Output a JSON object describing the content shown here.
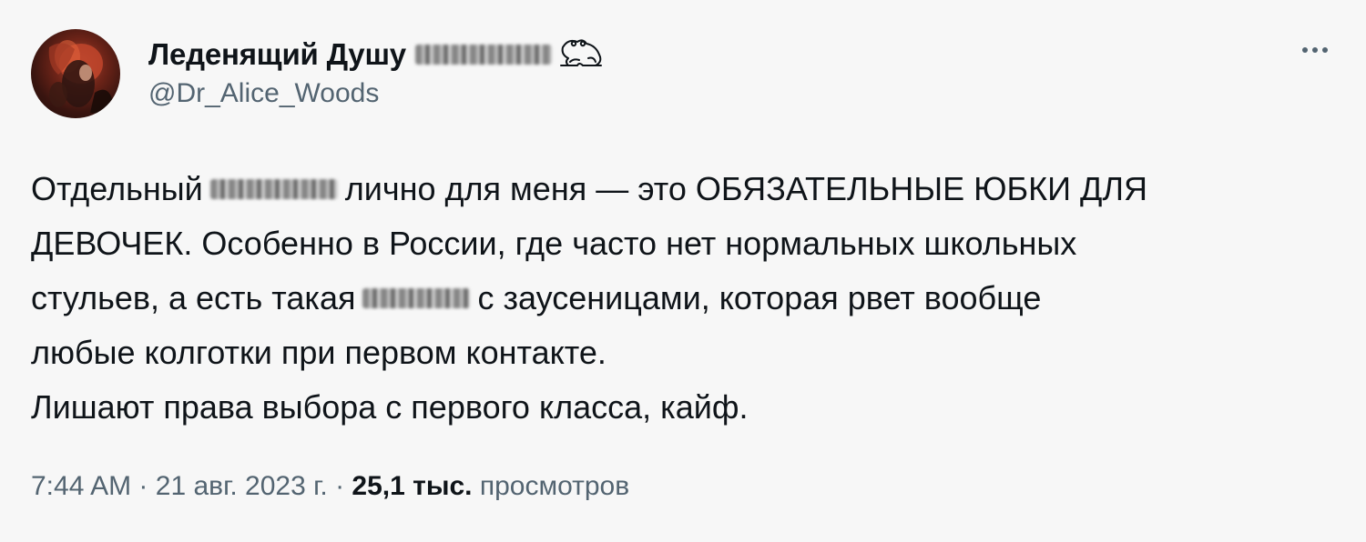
{
  "author": {
    "display_name": "Леденящий Душу",
    "handle": "@Dr_Alice_Woods",
    "badge_icon": "frog-icon"
  },
  "tweet": {
    "lines": [
      [
        "Отдельный",
        "личнo для меня — это ОБЯЗАТЕЛЬНЫЕ ЮБКИ ДЛЯ"
      ],
      [
        "ДЕВОЧЕК. Особенно в России, где часто нет нормальных школьных"
      ],
      [
        "стульев, а есть такая",
        "с заусеницами, которая рвет вообще"
      ],
      [
        "любые колготки при первом контакте."
      ],
      [
        "Лишают права выбора с первого класса, кайф."
      ]
    ]
  },
  "meta": {
    "time": "7:44 AM",
    "date": "21 авг. 2023 г.",
    "separator": "·",
    "views_count": "25,1 тыс.",
    "views_label": "просмотров"
  },
  "colors": {
    "background": "#f7f7f7",
    "text_primary": "#0f1419",
    "text_secondary": "#536471"
  }
}
